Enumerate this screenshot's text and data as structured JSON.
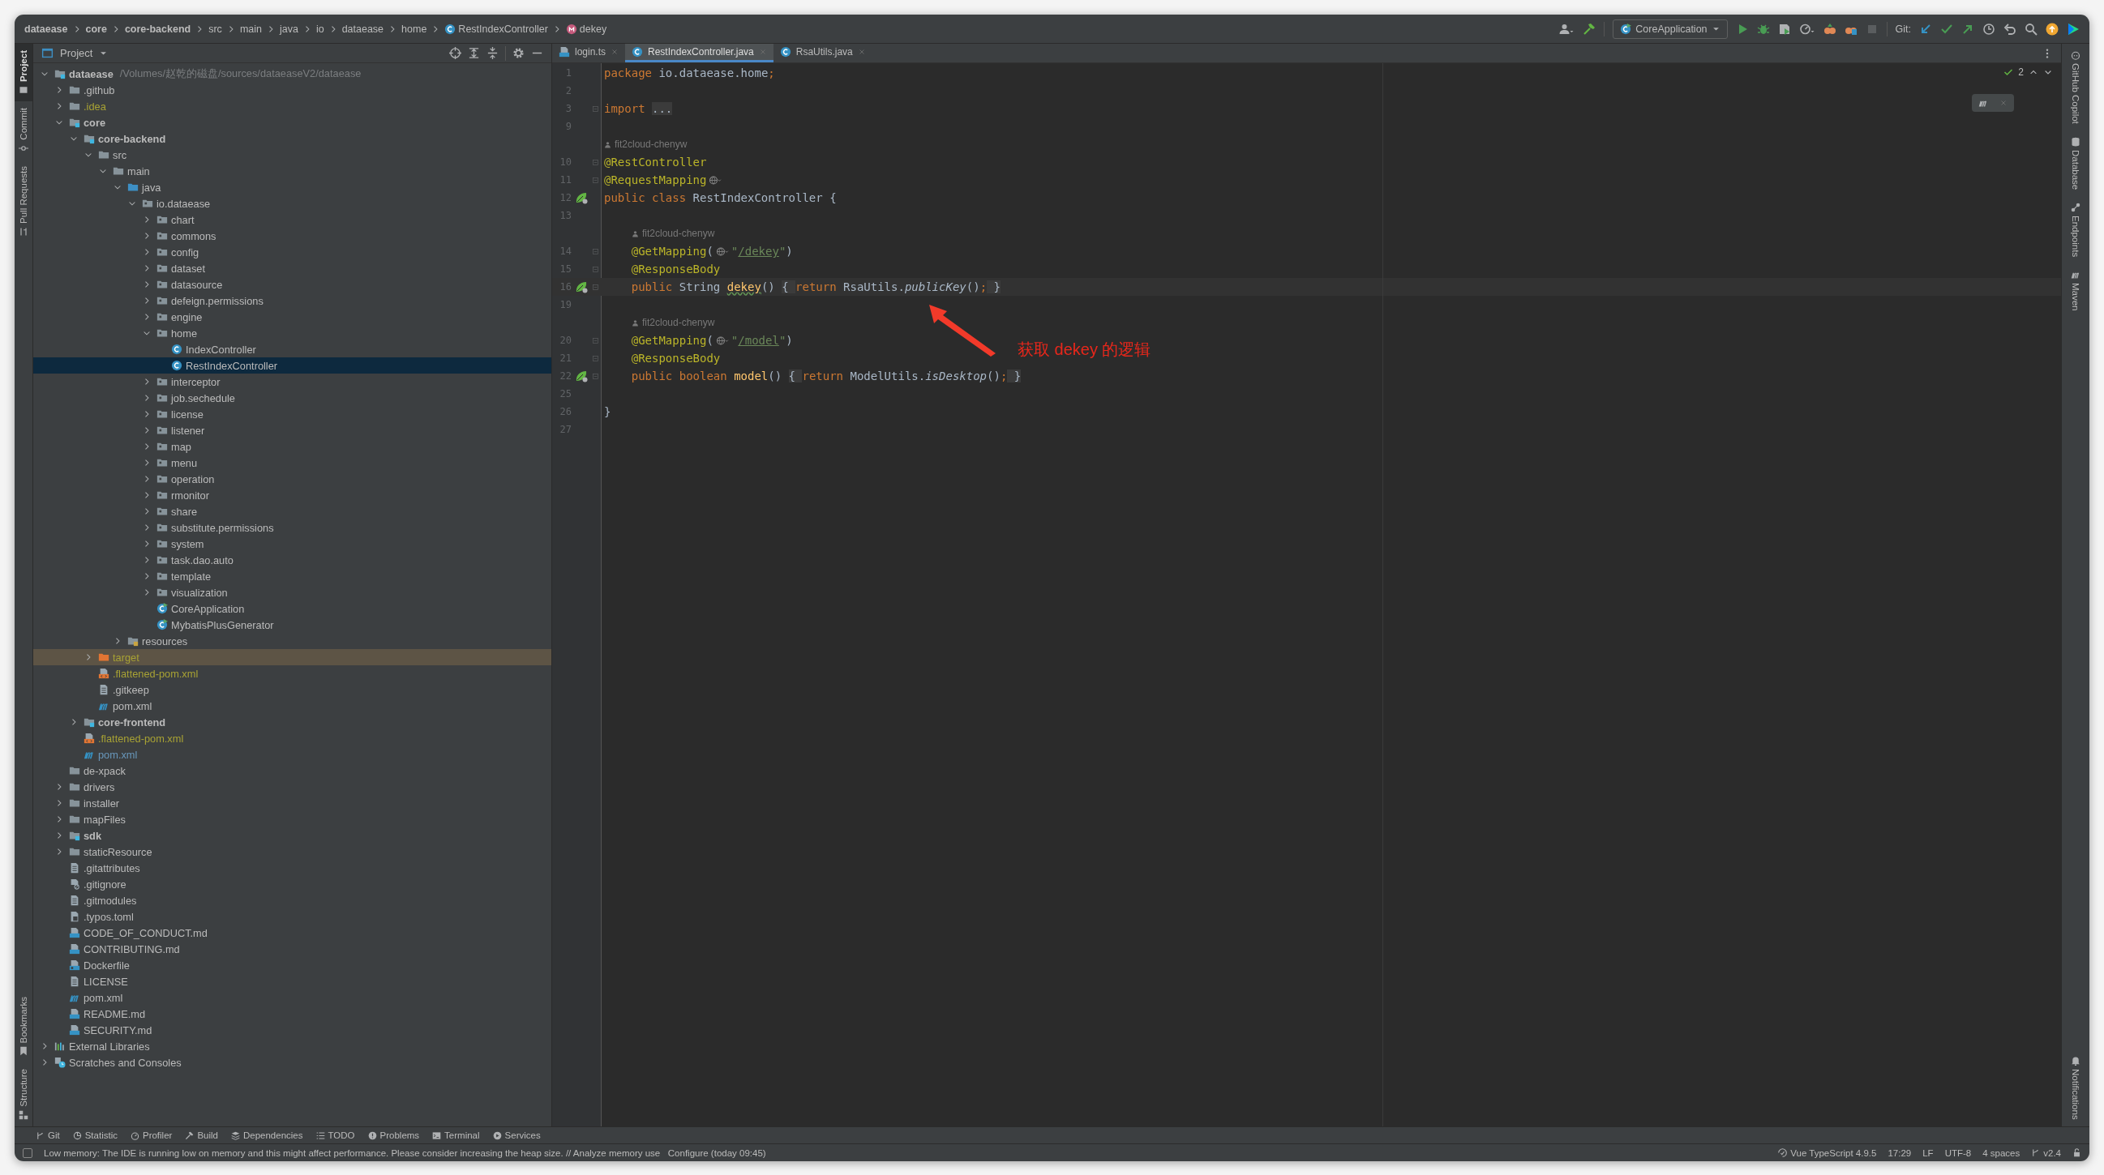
{
  "breadcrumbs": [
    {
      "label": "dataease",
      "kind": "module"
    },
    {
      "label": "core",
      "kind": "module"
    },
    {
      "label": "core-backend",
      "kind": "module"
    },
    {
      "label": "src",
      "kind": "folder"
    },
    {
      "label": "main",
      "kind": "folder"
    },
    {
      "label": "java",
      "kind": "folder"
    },
    {
      "label": "io",
      "kind": "folder"
    },
    {
      "label": "dataease",
      "kind": "folder"
    },
    {
      "label": "home",
      "kind": "folder"
    },
    {
      "label": "RestIndexController",
      "kind": "class"
    },
    {
      "label": "dekey",
      "kind": "method"
    }
  ],
  "toolbar": {
    "run_configuration": "CoreApplication",
    "git_label": "Git:"
  },
  "left_strip": {
    "top": [
      {
        "label": "Project",
        "kind": "project",
        "selected": true
      },
      {
        "label": "Commit",
        "kind": "commit",
        "selected": false
      },
      {
        "label": "Pull Requests",
        "kind": "pr",
        "selected": false
      }
    ],
    "bottom": [
      {
        "label": "Bookmarks",
        "kind": "bookmark",
        "selected": false
      },
      {
        "label": "Structure",
        "kind": "structure",
        "selected": false
      }
    ]
  },
  "project": {
    "title": "Project",
    "tree": [
      {
        "name": "dataease",
        "kind": "module",
        "path": "/Volumes/赵乾的磁盘/sources/dataeaseV2/dataease",
        "expanded": true,
        "selected": false,
        "children": [
          {
            "name": ".github",
            "kind": "folder",
            "expanded": false,
            "selected": false
          },
          {
            "name": ".idea",
            "kind": "folder",
            "expanded": false,
            "selected": false,
            "ignored": true
          },
          {
            "name": "core",
            "kind": "module",
            "expanded": true,
            "selected": false,
            "children": [
              {
                "name": "core-backend",
                "kind": "module",
                "expanded": true,
                "selected": false,
                "children": [
                  {
                    "name": "src",
                    "kind": "folder",
                    "expanded": true,
                    "selected": false,
                    "children": [
                      {
                        "name": "main",
                        "kind": "folder",
                        "expanded": true,
                        "selected": false,
                        "children": [
                          {
                            "name": "java",
                            "kind": "source",
                            "expanded": true,
                            "selected": false,
                            "children": [
                              {
                                "name": "io.dataease",
                                "kind": "package",
                                "expanded": true,
                                "selected": false,
                                "children": [
                                  {
                                    "name": "chart",
                                    "kind": "package",
                                    "expanded": false,
                                    "selected": false
                                  },
                                  {
                                    "name": "commons",
                                    "kind": "package",
                                    "expanded": false,
                                    "selected": false
                                  },
                                  {
                                    "name": "config",
                                    "kind": "package",
                                    "expanded": false,
                                    "selected": false
                                  },
                                  {
                                    "name": "dataset",
                                    "kind": "package",
                                    "expanded": false,
                                    "selected": false
                                  },
                                  {
                                    "name": "datasource",
                                    "kind": "package",
                                    "expanded": false,
                                    "selected": false
                                  },
                                  {
                                    "name": "defeign.permissions",
                                    "kind": "package",
                                    "expanded": false,
                                    "selected": false
                                  },
                                  {
                                    "name": "engine",
                                    "kind": "package",
                                    "expanded": false,
                                    "selected": false
                                  },
                                  {
                                    "name": "home",
                                    "kind": "package",
                                    "expanded": true,
                                    "selected": false,
                                    "children": [
                                      {
                                        "name": "IndexController",
                                        "kind": "class",
                                        "selected": false
                                      },
                                      {
                                        "name": "RestIndexController",
                                        "kind": "class",
                                        "selected": true
                                      }
                                    ]
                                  },
                                  {
                                    "name": "interceptor",
                                    "kind": "package",
                                    "expanded": false,
                                    "selected": false
                                  },
                                  {
                                    "name": "job.sechedule",
                                    "kind": "package",
                                    "expanded": false,
                                    "selected": false
                                  },
                                  {
                                    "name": "license",
                                    "kind": "package",
                                    "expanded": false,
                                    "selected": false
                                  },
                                  {
                                    "name": "listener",
                                    "kind": "package",
                                    "expanded": false,
                                    "selected": false
                                  },
                                  {
                                    "name": "map",
                                    "kind": "package",
                                    "expanded": false,
                                    "selected": false
                                  },
                                  {
                                    "name": "menu",
                                    "kind": "package",
                                    "expanded": false,
                                    "selected": false
                                  },
                                  {
                                    "name": "operation",
                                    "kind": "package",
                                    "expanded": false,
                                    "selected": false
                                  },
                                  {
                                    "name": "rmonitor",
                                    "kind": "package",
                                    "expanded": false,
                                    "selected": false
                                  },
                                  {
                                    "name": "share",
                                    "kind": "package",
                                    "expanded": false,
                                    "selected": false
                                  },
                                  {
                                    "name": "substitute.permissions",
                                    "kind": "package",
                                    "expanded": false,
                                    "selected": false
                                  },
                                  {
                                    "name": "system",
                                    "kind": "package",
                                    "expanded": false,
                                    "selected": false
                                  },
                                  {
                                    "name": "task.dao.auto",
                                    "kind": "package",
                                    "expanded": false,
                                    "selected": false
                                  },
                                  {
                                    "name": "template",
                                    "kind": "package",
                                    "expanded": false,
                                    "selected": false
                                  },
                                  {
                                    "name": "visualization",
                                    "kind": "package",
                                    "expanded": false,
                                    "selected": false
                                  },
                                  {
                                    "name": "CoreApplication",
                                    "kind": "app",
                                    "selected": false
                                  },
                                  {
                                    "name": "MybatisPlusGenerator",
                                    "kind": "app",
                                    "selected": false
                                  }
                                ]
                              }
                            ]
                          },
                          {
                            "name": "resources",
                            "kind": "resources",
                            "expanded": false,
                            "selected": false
                          }
                        ]
                      }
                    ]
                  },
                  {
                    "name": "target",
                    "kind": "excluded",
                    "expanded": false,
                    "selected": false,
                    "excluded": true
                  },
                  {
                    "name": ".flattened-pom.xml",
                    "kind": "xml",
                    "selected": false,
                    "ignored": true
                  },
                  {
                    "name": ".gitkeep",
                    "kind": "file",
                    "selected": false
                  },
                  {
                    "name": "pom.xml",
                    "kind": "maven",
                    "selected": false
                  }
                ]
              },
              {
                "name": "core-frontend",
                "kind": "module",
                "expanded": false,
                "selected": false
              },
              {
                "name": ".flattened-pom.xml",
                "kind": "xml",
                "selected": false,
                "ignored": true
              },
              {
                "name": "pom.xml",
                "kind": "maven",
                "selected": false,
                "modified": true
              }
            ]
          },
          {
            "name": "de-xpack",
            "kind": "folder",
            "selected": false
          },
          {
            "name": "drivers",
            "kind": "folder",
            "expanded": false,
            "selected": false
          },
          {
            "name": "installer",
            "kind": "folder",
            "expanded": false,
            "selected": false
          },
          {
            "name": "mapFiles",
            "kind": "folder",
            "expanded": false,
            "selected": false
          },
          {
            "name": "sdk",
            "kind": "module",
            "expanded": false,
            "selected": false
          },
          {
            "name": "staticResource",
            "kind": "folder",
            "expanded": false,
            "selected": false
          },
          {
            "name": ".gitattributes",
            "kind": "file",
            "selected": false
          },
          {
            "name": ".gitignore",
            "kind": "ignore",
            "selected": false
          },
          {
            "name": ".gitmodules",
            "kind": "file",
            "selected": false
          },
          {
            "name": ".typos.toml",
            "kind": "toml",
            "selected": false
          },
          {
            "name": "CODE_OF_CONDUCT.md",
            "kind": "md",
            "selected": false
          },
          {
            "name": "CONTRIBUTING.md",
            "kind": "md",
            "selected": false
          },
          {
            "name": "Dockerfile",
            "kind": "docker",
            "selected": false
          },
          {
            "name": "LICENSE",
            "kind": "file",
            "selected": false
          },
          {
            "name": "pom.xml",
            "kind": "maven",
            "selected": false
          },
          {
            "name": "README.md",
            "kind": "md",
            "selected": false
          },
          {
            "name": "SECURITY.md",
            "kind": "md",
            "selected": false
          }
        ]
      },
      {
        "name": "External Libraries",
        "kind": "libraries",
        "expanded": false,
        "selected": false
      },
      {
        "name": "Scratches and Consoles",
        "kind": "scratches",
        "expanded": false,
        "selected": false
      }
    ]
  },
  "editor": {
    "tabs": [
      {
        "label": "login.ts",
        "kind": "ts",
        "selected": false
      },
      {
        "label": "RestIndexController.java",
        "kind": "class",
        "selected": true
      },
      {
        "label": "RsaUtils.java",
        "kind": "class",
        "selected": false
      }
    ],
    "problems_count": "2",
    "lines": [
      {
        "kind": "code",
        "number": "1",
        "tokens": [
          {
            "kind": "kw",
            "text": "package"
          },
          {
            "kind": "plain",
            "text": " io.dataease.home"
          },
          {
            "kind": "kw",
            "text": ";"
          }
        ]
      },
      {
        "kind": "code",
        "number": "2"
      },
      {
        "kind": "code",
        "number": "3",
        "fold": true,
        "tokens": [
          {
            "kind": "kw",
            "text": "import "
          },
          {
            "kind": "fold",
            "text": "..."
          }
        ]
      },
      {
        "kind": "code",
        "number": "9"
      },
      {
        "kind": "author",
        "text": "fit2cloud-chenyw",
        "inner": false
      },
      {
        "kind": "code",
        "number": "10",
        "fold": true,
        "tokens": [
          {
            "kind": "ann",
            "text": "@RestController"
          }
        ]
      },
      {
        "kind": "code",
        "number": "11",
        "fold": true,
        "tokens": [
          {
            "kind": "ann",
            "text": "@RequestMapping"
          },
          {
            "kind": "hint"
          }
        ]
      },
      {
        "kind": "code",
        "number": "12",
        "bean": true,
        "tokens": [
          {
            "kind": "kw",
            "text": "public class"
          },
          {
            "kind": "plain",
            "text": " RestIndexController {"
          }
        ]
      },
      {
        "kind": "code",
        "number": "13"
      },
      {
        "kind": "author",
        "text": "fit2cloud-chenyw",
        "inner": true
      },
      {
        "kind": "code",
        "number": "14",
        "fold": true,
        "inner": true,
        "tokens": [
          {
            "kind": "ann",
            "text": "@GetMapping"
          },
          {
            "kind": "plain",
            "text": "("
          },
          {
            "kind": "hint"
          },
          {
            "kind": "str",
            "text": "\""
          },
          {
            "kind": "link",
            "text": "/dekey"
          },
          {
            "kind": "str",
            "text": "\""
          },
          {
            "kind": "plain",
            "text": ")"
          }
        ]
      },
      {
        "kind": "code",
        "number": "15",
        "fold": true,
        "inner": true,
        "tokens": [
          {
            "kind": "ann",
            "text": "@ResponseBody"
          }
        ]
      },
      {
        "kind": "code",
        "number": "16",
        "fold": true,
        "inner": true,
        "bean": true,
        "current": true,
        "tokens": [
          {
            "kind": "kw",
            "text": "public"
          },
          {
            "kind": "plain",
            "text": " String "
          },
          {
            "kind": "decl",
            "text": "dekey"
          },
          {
            "kind": "plain",
            "text": "() "
          },
          {
            "kind": "fold",
            "text": "{ "
          },
          {
            "kind": "kw",
            "text": "return"
          },
          {
            "kind": "plain",
            "text": " RsaUtils."
          },
          {
            "kind": "call",
            "text": "publicKey"
          },
          {
            "kind": "plain",
            "text": "()"
          },
          {
            "kind": "kw",
            "text": ";"
          },
          {
            "kind": "fold",
            "text": " }"
          }
        ]
      },
      {
        "kind": "code",
        "number": "19"
      },
      {
        "kind": "author",
        "text": "fit2cloud-chenyw",
        "inner": true
      },
      {
        "kind": "code",
        "number": "20",
        "fold": true,
        "inner": true,
        "tokens": [
          {
            "kind": "ann",
            "text": "@GetMapping"
          },
          {
            "kind": "plain",
            "text": "("
          },
          {
            "kind": "hint"
          },
          {
            "kind": "str",
            "text": "\""
          },
          {
            "kind": "link",
            "text": "/model"
          },
          {
            "kind": "str",
            "text": "\""
          },
          {
            "kind": "plain",
            "text": ")"
          }
        ]
      },
      {
        "kind": "code",
        "number": "21",
        "fold": true,
        "inner": true,
        "tokens": [
          {
            "kind": "ann",
            "text": "@ResponseBody"
          }
        ]
      },
      {
        "kind": "code",
        "number": "22",
        "fold": true,
        "inner": true,
        "bean": true,
        "tokens": [
          {
            "kind": "kw",
            "text": "public boolean "
          },
          {
            "kind": "method",
            "text": "model"
          },
          {
            "kind": "plain",
            "text": "() "
          },
          {
            "kind": "fold",
            "text": "{ "
          },
          {
            "kind": "kw",
            "text": "return"
          },
          {
            "kind": "plain",
            "text": " ModelUtils."
          },
          {
            "kind": "call",
            "text": "isDesktop"
          },
          {
            "kind": "plain",
            "text": "()"
          },
          {
            "kind": "kw",
            "text": ";"
          },
          {
            "kind": "fold",
            "text": " }"
          }
        ]
      },
      {
        "kind": "code",
        "number": "25"
      },
      {
        "kind": "code",
        "number": "26",
        "tokens": [
          {
            "kind": "plain",
            "text": "}"
          }
        ]
      },
      {
        "kind": "code",
        "number": "27"
      }
    ],
    "callout": {
      "text": "获取 dekey 的逻辑"
    }
  },
  "right_strip": [
    {
      "label": "GitHub Copilot",
      "kind": "copilot"
    },
    {
      "label": "Database",
      "kind": "database"
    },
    {
      "label": "Endpoints",
      "kind": "endpoints"
    },
    {
      "label": "Maven",
      "kind": "maven"
    }
  ],
  "right_strip_bottom": [
    {
      "label": "Notifications",
      "kind": "bell"
    }
  ],
  "tool_windows": [
    {
      "label": "Git",
      "kind": "git"
    },
    {
      "label": "Statistic",
      "kind": "stat"
    },
    {
      "label": "Profiler",
      "kind": "profiler"
    },
    {
      "label": "Build",
      "kind": "build"
    },
    {
      "label": "Dependencies",
      "kind": "deps"
    },
    {
      "label": "TODO",
      "kind": "todo"
    },
    {
      "label": "Problems",
      "kind": "problems"
    },
    {
      "label": "Terminal",
      "kind": "terminal"
    },
    {
      "label": "Services",
      "kind": "services"
    }
  ],
  "status_bar": {
    "message": "Low memory: The IDE is running low on memory and this might affect performance. Please consider increasing the heap size. // Analyze memory use   Configure (today 09:45)",
    "items": [
      {
        "label": "Vue TypeScript 4.9.5",
        "kind": "ts"
      },
      {
        "label": "17:29",
        "kind": "text"
      },
      {
        "label": "LF",
        "kind": "text"
      },
      {
        "label": "UTF-8",
        "kind": "text"
      },
      {
        "label": "4 spaces",
        "kind": "text"
      },
      {
        "label": "v2.4",
        "kind": "branch"
      }
    ]
  }
}
